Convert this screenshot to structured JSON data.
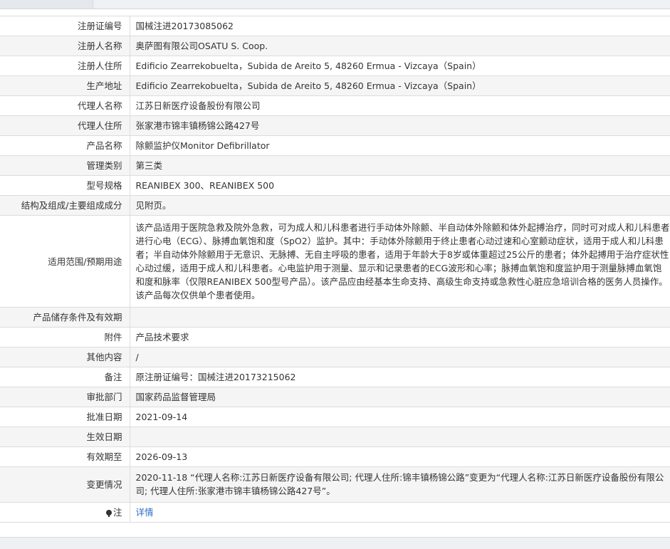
{
  "rows": [
    {
      "label": "注册证编号",
      "value": "国械注进20173085062"
    },
    {
      "label": "注册人名称",
      "value": "奥萨图有限公司OSATU S. Coop."
    },
    {
      "label": "注册人住所",
      "value": "Edificio Zearrekobuelta，Subida de Areito 5, 48260 Ermua - Vizcaya（Spain）"
    },
    {
      "label": "生产地址",
      "value": "Edificio Zearrekobuelta，Subida de Areito 5, 48260 Ermua - Vizcaya（Spain）"
    },
    {
      "label": "代理人名称",
      "value": "江苏日新医疗设备股份有限公司"
    },
    {
      "label": "代理人住所",
      "value": "张家港市锦丰镇杨锦公路427号"
    },
    {
      "label": "产品名称",
      "value": "除颤监护仪Monitor Defibrillator"
    },
    {
      "label": "管理类别",
      "value": "第三类"
    },
    {
      "label": "型号规格",
      "value": "REANIBEX 300、REANIBEX 500"
    },
    {
      "label": "结构及组成/主要组成成分",
      "value": "见附页。"
    },
    {
      "label": "适用范围/预期用途",
      "value": "该产品适用于医院急救及院外急救，可为成人和儿科患者进行手动体外除颤、半自动体外除颤和体外起搏治疗，同时可对成人和儿科患者进行心电（ECG）、脉搏血氧饱和度（SpO2）监护。其中：手动体外除颤用于终止患者心动过速和心室颤动症状，适用于成人和儿科患者；半自动体外除颤用于无意识、无脉搏、无自主呼吸的患者，适用于年龄大于8岁或体重超过25公斤的患者；体外起搏用于治疗症状性心动过缓，适用于成人和儿科患者。心电监护用于测量、显示和记录患者的ECG波形和心率；脉搏血氧饱和度监护用于测量脉搏血氧饱和度和脉率（仅限REANIBEX 500型号产品）。该产品应由经基本生命支持、高级生命支持或急救性心脏应急培训合格的医务人员操作。该产品每次仅供单个患者使用。"
    },
    {
      "label": "产品储存条件及有效期",
      "value": ""
    },
    {
      "label": "附件",
      "value": "产品技术要求"
    },
    {
      "label": "其他内容",
      "value": "/"
    },
    {
      "label": "备注",
      "value": "原注册证编号：国械注进20173215062"
    },
    {
      "label": "审批部门",
      "value": "国家药品监督管理局"
    },
    {
      "label": "批准日期",
      "value": "2021-09-14"
    },
    {
      "label": "生效日期",
      "value": ""
    },
    {
      "label": "有效期至",
      "value": "2026-09-13"
    },
    {
      "label": "变更情况",
      "value": "2020-11-18 “代理人名称:江苏日新医疗设备有限公司; 代理人住所:锦丰镇杨锦公路”变更为“代理人名称:江苏日新医疗设备股份有限公司; 代理人住所:张家港市锦丰镇杨锦公路427号”。"
    }
  ],
  "note_row": {
    "label": "注",
    "icon": "pin-icon",
    "link_text": "详情"
  }
}
